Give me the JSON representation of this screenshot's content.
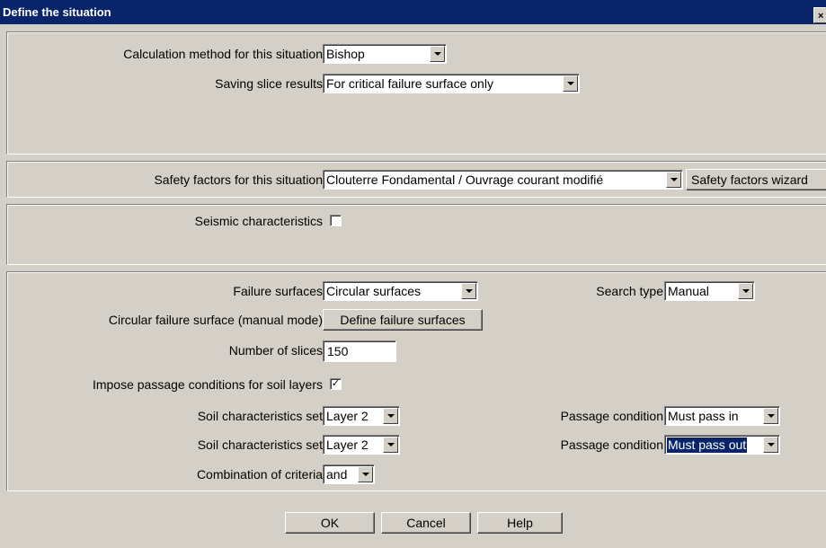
{
  "window": {
    "title": "Define the situation",
    "close_glyph": "×"
  },
  "calc": {
    "method_label": "Calculation method for this situation",
    "method_value": "Bishop",
    "saving_label": "Saving slice results",
    "saving_value": "For critical failure surface only"
  },
  "safety": {
    "label": "Safety factors for this situation",
    "value": "Clouterre Fondamental / Ouvrage courant modifié",
    "wizard_label": "Safety factors wizard"
  },
  "seismic": {
    "label": "Seismic characteristics",
    "checked": false
  },
  "failure": {
    "surfaces_label": "Failure surfaces",
    "surfaces_value": "Circular surfaces",
    "search_type_label": "Search type",
    "search_type_value": "Manual",
    "circular_label": "Circular failure surface (manual mode)",
    "define_button": "Define failure surfaces",
    "slices_label": "Number of slices",
    "slices_value": "150",
    "impose_label": "Impose passage conditions for soil layers",
    "impose_checked": true,
    "check_glyph": "✓",
    "soil_rows": [
      {
        "soil_label": "Soil characteristics set",
        "soil_value": "Layer 2",
        "passage_label": "Passage condition",
        "passage_value": "Must pass in"
      },
      {
        "soil_label": "Soil characteristics set",
        "soil_value": "Layer 2",
        "passage_label": "Passage condition",
        "passage_value": "Must pass out"
      }
    ],
    "combination_label": "Combination of criteria",
    "combination_value": "and"
  },
  "buttons": {
    "ok": "OK",
    "cancel": "Cancel",
    "help": "Help"
  },
  "colors": {
    "titlebar": "#0a246a",
    "face": "#d4d0c8",
    "selection": "#0a246a"
  }
}
